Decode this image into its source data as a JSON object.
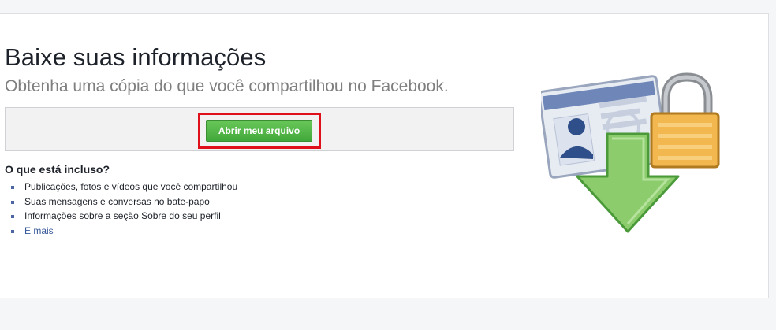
{
  "page": {
    "title": "Baixe suas informações",
    "subtitle": "Obtenha uma cópia do que você compartilhou no Facebook.",
    "download_button": "Abrir meu arquivo",
    "included": {
      "heading": "O que está incluso?",
      "items": [
        "Publicações, fotos e vídeos que você compartilhou",
        "Suas mensagens e conversas no bate-papo",
        "Informações sobre a seção Sobre do seu perfil"
      ],
      "more_link": "E mais"
    }
  },
  "colors": {
    "button_green": "#42a83b",
    "highlight_red": "#e0101b",
    "link_blue": "#365899"
  },
  "illustration": {
    "icons": [
      "id-card-icon",
      "padlock-icon",
      "download-arrow-icon"
    ]
  }
}
